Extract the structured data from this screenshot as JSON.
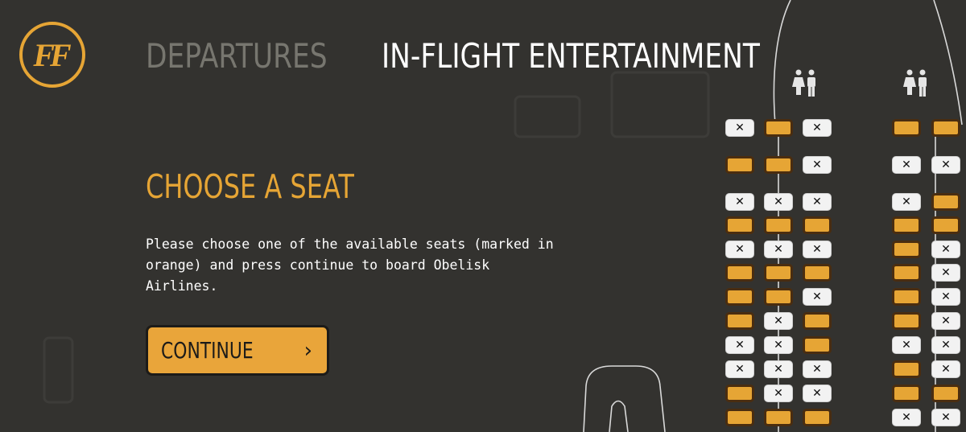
{
  "logo": {
    "text": "FF"
  },
  "nav": {
    "departures": "DEPARTURES",
    "inflight": "IN-FLIGHT ENTERTAINMENT"
  },
  "main": {
    "title": "CHOOSE A SEAT",
    "description": "Please choose one of the available seats (marked in orange) and press continue to board Obelisk Airlines.",
    "continue_label": "CONTINUE",
    "continue_icon": "chevron-right-icon"
  },
  "seat_map": {
    "restroom_icon": "restroom-icon",
    "taken_mark": "✕",
    "colors": {
      "available": "#e6a535",
      "taken": "#f2f2f2",
      "background": "#33322f"
    },
    "rows": [
      [
        "taken",
        "available",
        "taken",
        "available",
        "available"
      ],
      [
        "available",
        "available",
        "taken",
        "taken",
        "taken"
      ],
      [
        "taken",
        "taken",
        "taken",
        "taken",
        "available"
      ],
      [
        "available",
        "available",
        "available",
        "available",
        "available"
      ],
      [
        "taken",
        "taken",
        "taken",
        "available",
        "taken"
      ],
      [
        "available",
        "available",
        "available",
        "available",
        "taken"
      ],
      [
        "available",
        "available",
        "taken",
        "available",
        "taken"
      ],
      [
        "available",
        "taken",
        "available",
        "available",
        "taken"
      ],
      [
        "taken",
        "taken",
        "available",
        "taken",
        "taken"
      ],
      [
        "taken",
        "taken",
        "taken",
        "available",
        "taken"
      ],
      [
        "available",
        "taken",
        "taken",
        "available",
        "available"
      ],
      [
        "available",
        "available",
        "available",
        "taken",
        "taken"
      ]
    ]
  }
}
